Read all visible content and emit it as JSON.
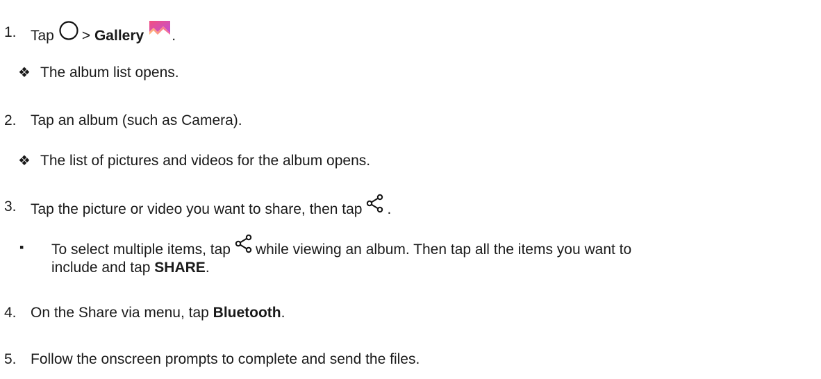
{
  "steps": [
    {
      "num": "1.",
      "pre": "Tap",
      "sep": ">",
      "gallery": "Gallery",
      "post": ".",
      "icons": [
        "home-circle-icon",
        "gallery-app-icon"
      ]
    },
    {
      "num": "2.",
      "text": "Tap an album (such as Camera)."
    },
    {
      "num": "3.",
      "pre": "Tap the picture or video you want to share, then tap",
      "post": ".",
      "icons": [
        "share-icon"
      ]
    },
    {
      "num": "4.",
      "pre": "On the Share via menu, tap ",
      "bold": "Bluetooth",
      "post": "."
    },
    {
      "num": "5.",
      "text": "Follow the onscreen prompts to complete and send the files."
    }
  ],
  "results": [
    {
      "marker": "❖",
      "text": "The album list opens."
    },
    {
      "marker": "❖",
      "text": "The list of pictures and videos for the album opens."
    }
  ],
  "note": {
    "marker": "▪",
    "pre": "To select multiple items, tap",
    "mid": "while viewing an album. Then tap all the items you want to",
    "line2_pre": "include and tap ",
    "bold": "SHARE",
    "post": "."
  },
  "colors": {
    "text": "#1a1a1a",
    "gallery_gradient": [
      "#f2507f",
      "#c04fd6",
      "#ffc06b"
    ]
  }
}
